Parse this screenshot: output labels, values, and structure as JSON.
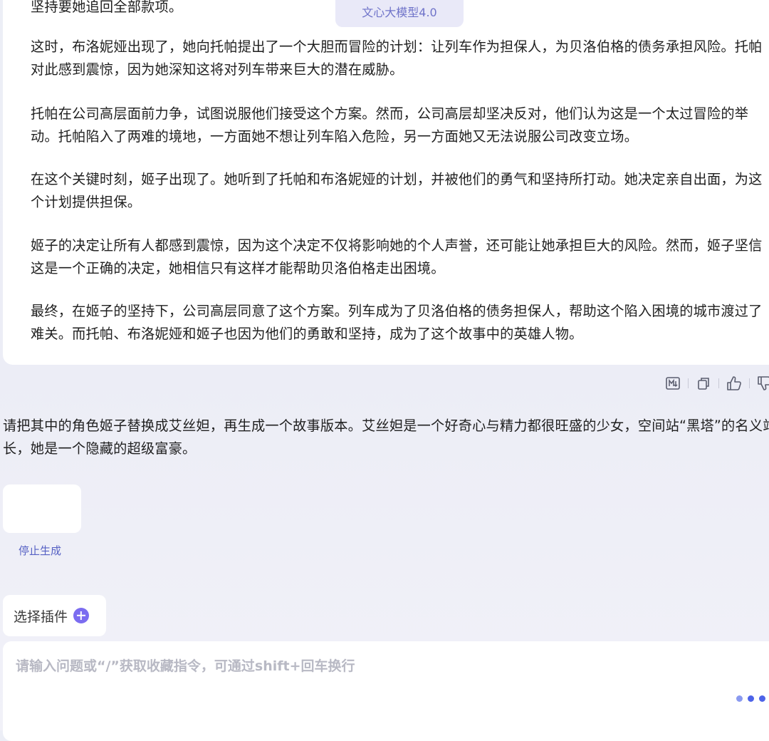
{
  "model_badge": "文心大模型4.0",
  "answer": {
    "paragraphs": [
      "坚持要她追回全部款项。",
      "这时，布洛妮娅出现了，她向托帕提出了一个大胆而冒险的计划：让列车作为担保人，为贝洛伯格的债务承担风险。托帕对此感到震惊，因为她深知这将对列车带来巨大的潜在威胁。",
      "托帕在公司高层面前力争，试图说服他们接受这个方案。然而，公司高层却坚决反对，他们认为这是一个太过冒险的举动。托帕陷入了两难的境地，一方面她不想让列车陷入危险，另一方面她又无法说服公司改变立场。",
      "在这个关键时刻，姬子出现了。她听到了托帕和布洛妮娅的计划，并被他们的勇气和坚持所打动。她决定亲自出面，为这个计划提供担保。",
      "姬子的决定让所有人都感到震惊，因为这个决定不仅将影响她的个人声誉，还可能让她承担巨大的风险。然而，姬子坚信这是一个正确的决定，她相信只有这样才能帮助贝洛伯格走出困境。",
      "最终，在姬子的坚持下，公司高层同意了这个方案。列车成为了贝洛伯格的债务担保人，帮助这个陷入困境的城市渡过了难关。而托帕、布洛妮娅和姬子也因为他们的勇敢和坚持，成为了这个故事中的英雄人物。"
    ]
  },
  "actions": {
    "icons": [
      "markdown-icon",
      "copy-icon",
      "thumbs-up-icon",
      "thumbs-down-icon"
    ]
  },
  "user_message": "请把其中的角色姬子替换成艾丝妲，再生成一个故事版本。艾丝妲是一个好奇心与精力都很旺盛的少女，空间站“黑塔”的名义站长，她是一个隐藏的超级富豪。",
  "stop_label": "停止生成",
  "plugin_label": "选择插件",
  "input": {
    "placeholder": "请输入问题或“/”获取收藏指令，可通过shift+回车换行"
  },
  "colors": {
    "accent": "#4d63e8",
    "plugin_plus": "#7b6cf0",
    "stop_link": "#5661c4",
    "badge_text": "#6f73c9"
  }
}
